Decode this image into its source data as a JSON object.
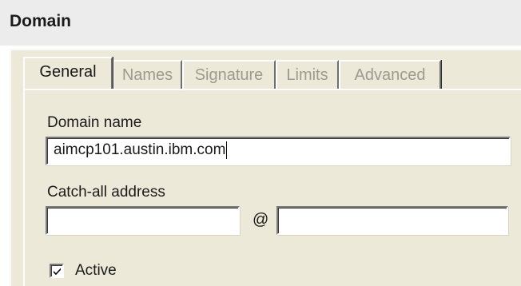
{
  "header": {
    "title": "Domain"
  },
  "tabs": [
    {
      "label": "General",
      "active": true
    },
    {
      "label": "Names",
      "active": false
    },
    {
      "label": "Signature",
      "active": false
    },
    {
      "label": "Limits",
      "active": false
    },
    {
      "label": "Advanced",
      "active": false
    }
  ],
  "general": {
    "domain_name_label": "Domain name",
    "domain_name_value": "aimcp101.austin.ibm.com",
    "catch_all_label": "Catch-all address",
    "catch_all_user_value": "",
    "at_symbol": "@",
    "catch_all_domain_value": "",
    "active_label": "Active",
    "active_checked": true
  },
  "colors": {
    "header_bg": "#ececec",
    "dialog_bg": "#ece9d8",
    "disabled_text": "#9d9a8f",
    "text": "#1a1a1a"
  }
}
